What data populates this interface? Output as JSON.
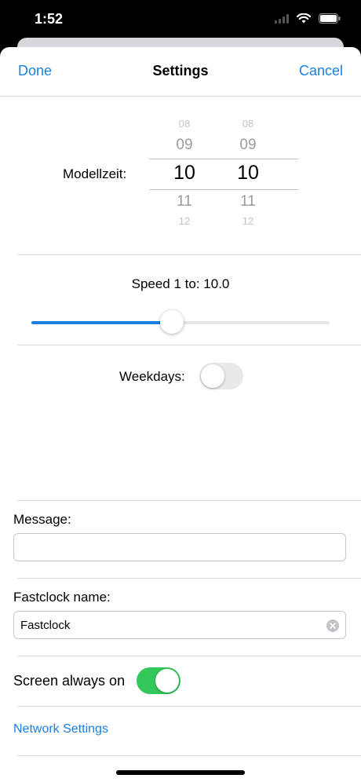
{
  "status_bar": {
    "time": "1:52"
  },
  "nav": {
    "done_label": "Done",
    "title": "Settings",
    "cancel_label": "Cancel"
  },
  "time_picker": {
    "label": "Modellzeit:",
    "hours": {
      "m2": "08",
      "m1": "09",
      "selected": "10",
      "p1": "11",
      "p2": "12"
    },
    "minutes": {
      "m2": "08",
      "m1": "09",
      "selected": "10",
      "p1": "11",
      "p2": "12"
    }
  },
  "speed": {
    "label": "Speed 1 to:  10.0",
    "slider_fraction": 0.47
  },
  "weekdays": {
    "label": "Weekdays:",
    "on": false
  },
  "message": {
    "label": "Message:",
    "value": "",
    "placeholder": ""
  },
  "fastclock_name": {
    "label": "Fastclock name:",
    "value": "Fastclock"
  },
  "screen_always_on": {
    "label": "Screen always on",
    "on": true
  },
  "network_settings": {
    "label": "Network Settings"
  },
  "colors": {
    "accent": "#1a7fe0",
    "toggle_on": "#34c759",
    "toggle_off": "#e9e9eb"
  }
}
